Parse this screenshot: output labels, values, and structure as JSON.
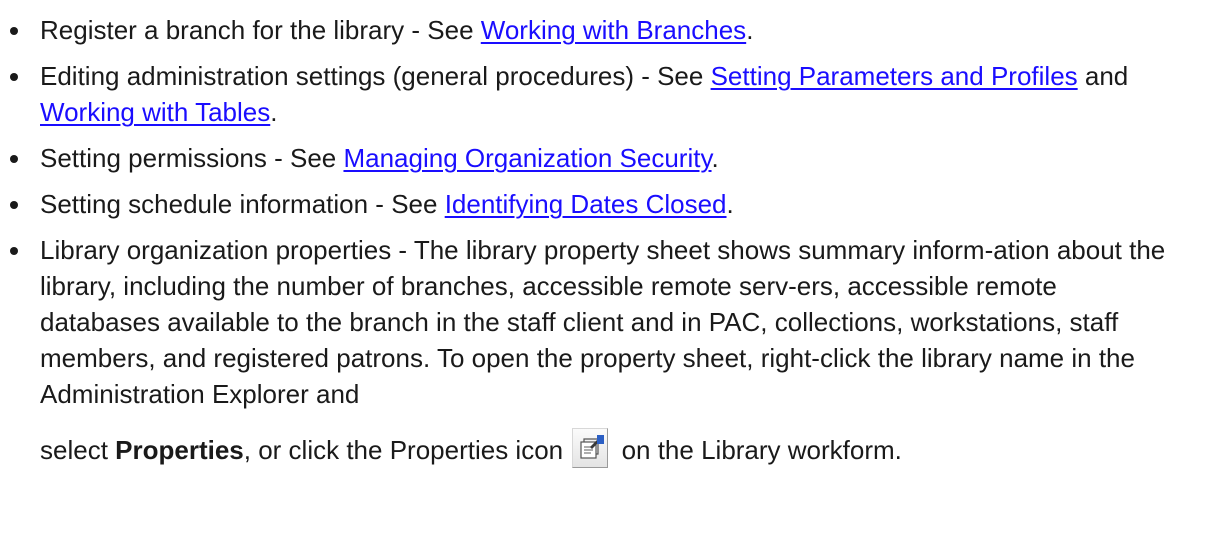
{
  "colors": {
    "text": "#1a1a1a",
    "link": "#1a0dff"
  },
  "items": [
    {
      "pre": "Register a branch for the library - See ",
      "link": "Working with Branches",
      "post": "."
    },
    {
      "pre": "Editing administration settings (general procedures) - See ",
      "link1": "Setting Parameters and Profiles",
      "mid": " and ",
      "link2": "Working with Tables",
      "post": "."
    },
    {
      "pre": "Setting permissions - See ",
      "link": "Managing Organization Security",
      "post": "."
    },
    {
      "pre": "Setting schedule information - See ",
      "link": "Identifying Dates Closed",
      "post": "."
    },
    {
      "text": "Library organization properties - The library property sheet shows summary inform-ation about the library, including the number of branches, accessible remote serv-ers, accessible remote databases available to the branch in the staff client and in PAC, collections, workstations, staff members, and registered patrons. To open the property sheet, right-click the library name in the Administration Explorer and",
      "select_word": "select ",
      "properties_bold": "Properties",
      "after_bold": ", or click the Properties icon ",
      "icon_name": "properties-icon",
      "tail": " on the Library workform."
    }
  ]
}
